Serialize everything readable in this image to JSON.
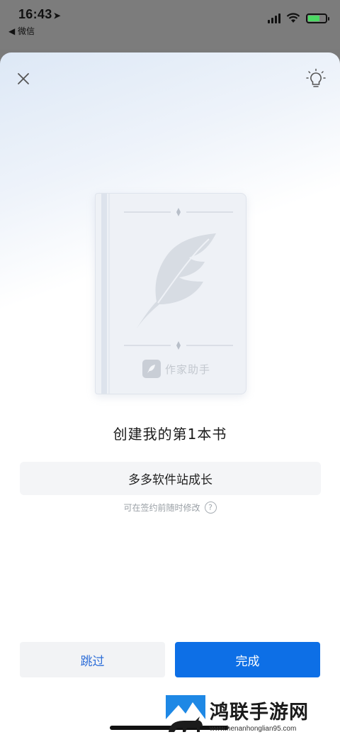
{
  "status_bar": {
    "time": "16:43",
    "back_app": "◀ 微信"
  },
  "icons": {
    "close": "close-icon",
    "tips": "lightbulb-icon",
    "help": "question-icon",
    "brand": "feather-pen-icon"
  },
  "book": {
    "brand_name": "作家助手"
  },
  "main": {
    "title": "创建我的第1本书",
    "book_name_value": "多多软件站成长",
    "hint": "可在签约前随时修改",
    "help_symbol": "?"
  },
  "actions": {
    "skip_label": "跳过",
    "done_label": "完成"
  },
  "watermark": {
    "title": "鸿联手游网",
    "url": "www.henanhonglian95.com"
  },
  "colors": {
    "accent": "#0d6fe6",
    "skip_text": "#2f6fd8",
    "battery": "#4cd964"
  }
}
